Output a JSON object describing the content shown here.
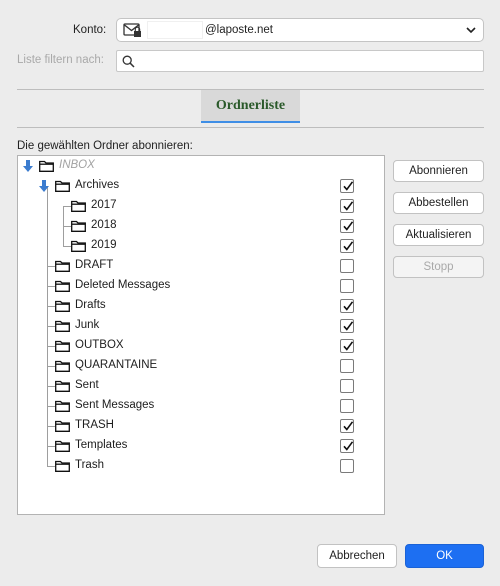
{
  "account": {
    "label": "Konto:",
    "value_domain": "@laposte.net",
    "icon": "mail-lock-icon"
  },
  "filter": {
    "label": "Liste filtern nach:",
    "value": "",
    "placeholder": ""
  },
  "tabs": [
    {
      "label": "Ordnerliste",
      "active": true
    }
  ],
  "subscribe_prompt": "Die gewählten Ordner abonnieren:",
  "folders": [
    {
      "name": "INBOX",
      "checked": null
    },
    {
      "name": "Archives",
      "checked": true
    },
    {
      "name": "2017",
      "checked": true
    },
    {
      "name": "2018",
      "checked": true
    },
    {
      "name": "2019",
      "checked": true
    },
    {
      "name": "DRAFT",
      "checked": false
    },
    {
      "name": "Deleted Messages",
      "checked": false
    },
    {
      "name": "Drafts",
      "checked": true
    },
    {
      "name": "Junk",
      "checked": true
    },
    {
      "name": "OUTBOX",
      "checked": true
    },
    {
      "name": "QUARANTAINE",
      "checked": false
    },
    {
      "name": "Sent",
      "checked": false
    },
    {
      "name": "Sent Messages",
      "checked": false
    },
    {
      "name": "TRASH",
      "checked": true
    },
    {
      "name": "Templates",
      "checked": true
    },
    {
      "name": "Trash",
      "checked": false
    }
  ],
  "side_buttons": {
    "subscribe": "Abonnieren",
    "unsubscribe": "Abbestellen",
    "refresh": "Aktualisieren",
    "stop": "Stopp"
  },
  "footer": {
    "cancel": "Abbrechen",
    "ok": "OK"
  },
  "colors": {
    "accent": "#1d6ff2",
    "tab_underline": "#3e8ee6",
    "tab_text": "#2a5a2a",
    "expander_arrow": "#3b7ccf"
  }
}
